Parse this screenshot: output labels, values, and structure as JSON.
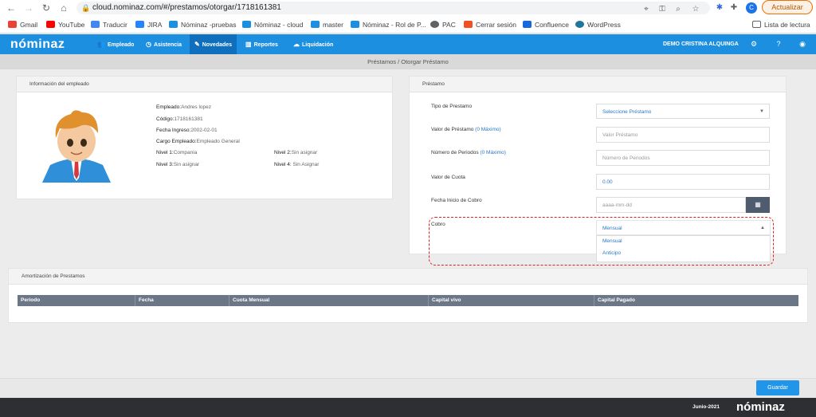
{
  "browser": {
    "url": "cloud.nominaz.com/#/prestamos/otorgar/1718161381",
    "profile_initial": "C",
    "update_label": "Actualizar",
    "bookmarks": [
      "Gmail",
      "YouTube",
      "Traducir",
      "JIRA",
      "Nóminaz -pruebas",
      "Nóminaz - cloud",
      "master",
      "Nóminaz - Rol de P...",
      "PAC",
      "Cerrar sesión",
      "Confluence",
      "WordPress"
    ],
    "reading_list": "Lista de lectura",
    "bookmark_colors": [
      "#ea4335",
      "#ff0000",
      "#4285f4",
      "#2684ff",
      "#1d8fe1",
      "#1d8fe1",
      "#1d8fe1",
      "#1d8fe1",
      "#5f6368",
      "#f25022",
      "#1868db",
      "#21759b"
    ]
  },
  "app": {
    "logo": "nóminaz",
    "nav": [
      "Empleado",
      "Asistencia",
      "Novedades",
      "Reportes",
      "Liquidación"
    ],
    "user": "DEMO CRISTINA ALQUINGA",
    "breadcrumb": "Préstamos / Otorgar Préstamo",
    "accent": "#1d8fe1"
  },
  "employee_panel": {
    "title": "Información del empleado",
    "fields": {
      "empleado_label": "Empleado:",
      "empleado": "Andres lopez",
      "codigo_label": "Código:",
      "codigo": "1718161381",
      "fecha_label": "Fecha Ingreso:",
      "fecha": "2002-02-01",
      "cargo_label": "Cargo Empleado:",
      "cargo": "Empleado General",
      "nivel1_label": "Nivel 1:",
      "nivel1": "Compania",
      "nivel2_label": "Nivel 2:",
      "nivel2": "Sin asignar",
      "nivel3_label": "Nivel 3:",
      "nivel3": "Sin asignar",
      "nivel4_label": "Nivel 4:",
      "nivel4": " Sin Asignar"
    }
  },
  "loan_panel": {
    "title": "Préstamo",
    "tipo_label": "Tipo de Prestamo",
    "tipo_value": "Seleccione Préstamo",
    "valor_label": "Valor de Préstamo",
    "valor_hint": "(0 Máximo)",
    "valor_placeholder": "Valor Préstamo",
    "periodos_label": "Número de Periodos",
    "periodos_hint": "(0 Máximo)",
    "periodos_placeholder": "Número de Periodos",
    "cuota_label": "Valor de Cuota",
    "cuota_value": "0.00",
    "fecha_label": "Fecha Inicio de Cobro",
    "fecha_placeholder": "aaaa-mm-dd",
    "cobro_label": "Cobro",
    "cobro_value": "Mensual",
    "cobro_options": [
      "Mensual",
      "Anticipo"
    ]
  },
  "amortizacion": {
    "title": "Amortización de Prestamos",
    "columns": [
      "Periodo",
      "Fecha",
      "Cuota Mensual",
      "Capital vivo",
      "Capital Pagado"
    ]
  },
  "footer": {
    "save_label": "Guardar",
    "date": "Junio-2021",
    "logo": "nóminaz"
  }
}
